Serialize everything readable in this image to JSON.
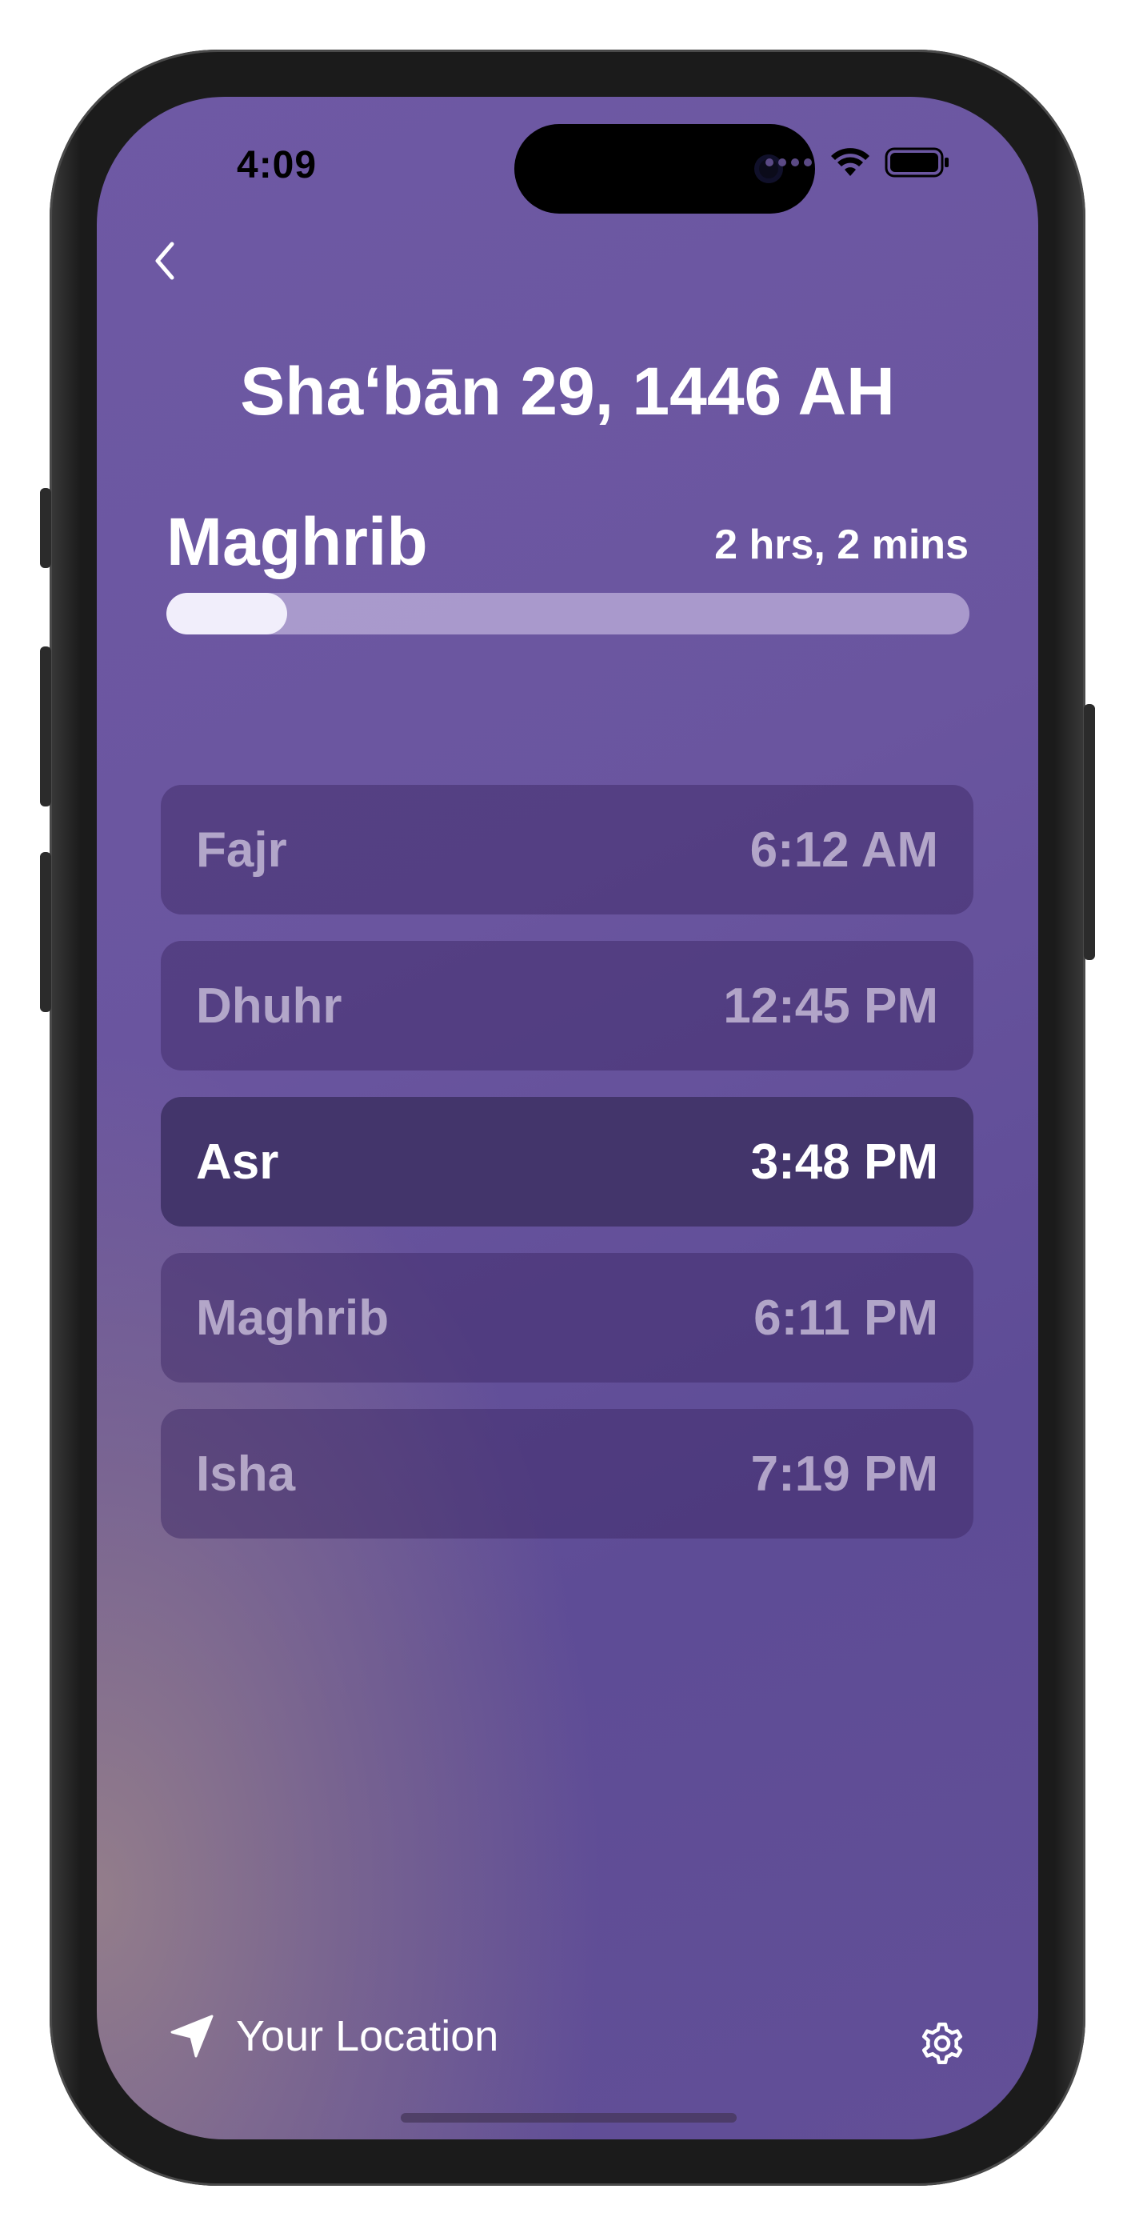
{
  "status_bar": {
    "time": "4:09"
  },
  "header": {
    "date": "Sha‘bān 29, 1446 AH"
  },
  "next_prayer": {
    "name": "Maghrib",
    "remaining": "2 hrs, 2 mins",
    "progress_fraction": 0.15
  },
  "prayers": [
    {
      "name": "Fajr",
      "time": "6:12 AM",
      "active": false
    },
    {
      "name": "Dhuhr",
      "time": "12:45 PM",
      "active": false
    },
    {
      "name": "Asr",
      "time": "3:48 PM",
      "active": true
    },
    {
      "name": "Maghrib",
      "time": "6:11 PM",
      "active": false
    },
    {
      "name": "Isha",
      "time": "7:19 PM",
      "active": false
    }
  ],
  "footer": {
    "location_label": "Your Location",
    "location_icon": "location-arrow-icon",
    "settings_icon": "gear-icon"
  },
  "colors": {
    "active_row": "#43356b",
    "progress_fill": "#f1eefb",
    "background": "#6e59a4"
  }
}
